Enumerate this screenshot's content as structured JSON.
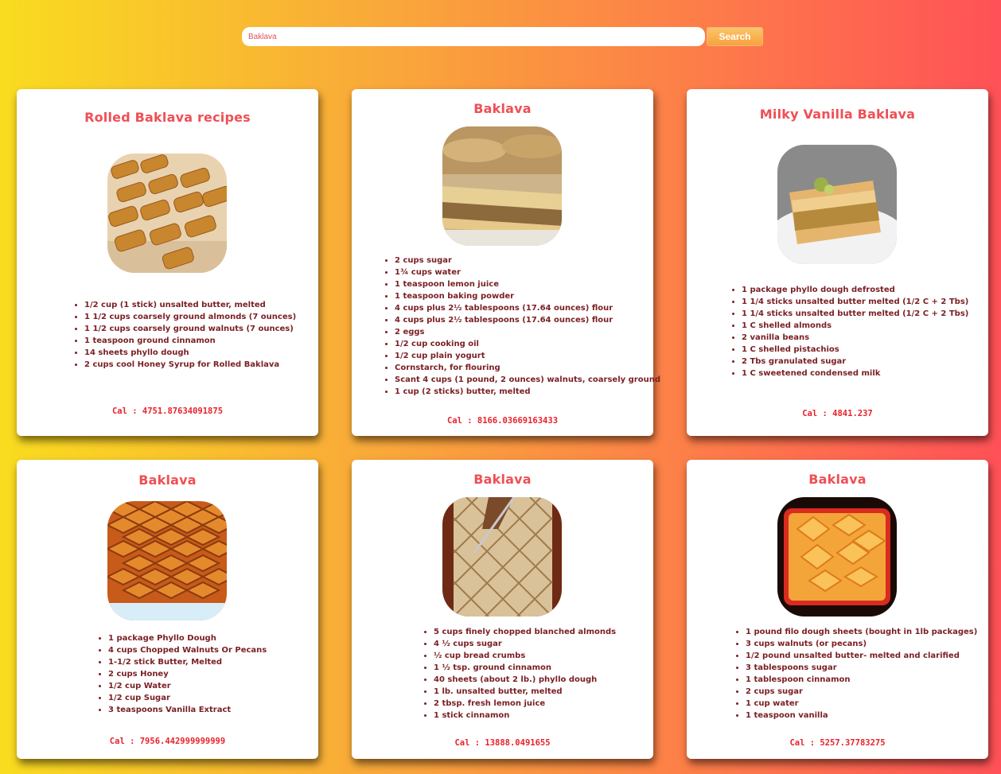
{
  "search": {
    "value": "Baklava",
    "button_label": "Search"
  },
  "recipes": [
    {
      "title": "Rolled Baklava recipes",
      "ingredients": [
        "1/2 cup (1 stick) unsalted butter, melted",
        "1 1/2 cups coarsely ground almonds (7 ounces)",
        "1 1/2 cups coarsely ground walnuts (7 ounces)",
        "1 teaspoon ground cinnamon",
        "14 sheets phyllo dough",
        "2 cups cool Honey Syrup for Rolled Baklava"
      ],
      "calories": "Cal : 4751.87634091875"
    },
    {
      "title": "Baklava",
      "ingredients": [
        "2 cups sugar",
        "1¾ cups water",
        "1 teaspoon lemon juice",
        "1 teaspoon baking powder",
        "4 cups plus 2½ tablespoons (17.64 ounces) flour",
        "4 cups plus 2½ tablespoons (17.64 ounces) flour",
        "2 eggs",
        "1/2 cup cooking oil",
        "1/2 cup plain yogurt",
        "Cornstarch, for flouring",
        "Scant 4 cups (1 pound, 2 ounces) walnuts, coarsely ground",
        "1 cup (2 sticks) butter, melted"
      ],
      "calories": "Cal : 8166.03669163433"
    },
    {
      "title": "Milky Vanilla Baklava",
      "ingredients": [
        "1 package phyllo dough defrosted",
        "1 1/4 sticks unsalted butter melted (1/2 C + 2 Tbs)",
        "1 1/4 sticks unsalted butter melted (1/2 C + 2 Tbs)",
        "1 C shelled almonds",
        "2 vanilla beans",
        "1 C shelled pistachios",
        "2 Tbs granulated sugar",
        "1 C sweetened condensed milk"
      ],
      "calories": "Cal : 4841.237"
    },
    {
      "title": "Baklava",
      "ingredients": [
        "1 package Phyllo Dough",
        "4 cups Chopped Walnuts Or Pecans",
        "1-1/2 stick Butter, Melted",
        "2 cups Honey",
        "1/2 cup Water",
        "1/2 cup Sugar",
        "3 teaspoons Vanilla Extract"
      ],
      "calories": "Cal : 7956.442999999999"
    },
    {
      "title": "Baklava",
      "ingredients": [
        "5 cups finely chopped blanched almonds",
        "4 ½ cups sugar",
        "½ cup bread crumbs",
        "1 ½ tsp. ground cinnamon",
        "40 sheets (about 2 lb.) phyllo dough",
        "1 lb. unsalted butter, melted",
        "2 tbsp. fresh lemon juice",
        "1 stick cinnamon"
      ],
      "calories": "Cal : 13888.0491655"
    },
    {
      "title": "Baklava",
      "ingredients": [
        "1 pound filo dough sheets (bought in 1lb packages)",
        "3 cups walnuts (or pecans)",
        "1/2 pound unsalted butter- melted and clarified",
        "3 tablespoons sugar",
        "1 tablespoon cinnamon",
        "2 cups sugar",
        "1 cup water",
        "1 teaspoon vanilla"
      ],
      "calories": "Cal : 5257.37783275"
    }
  ]
}
